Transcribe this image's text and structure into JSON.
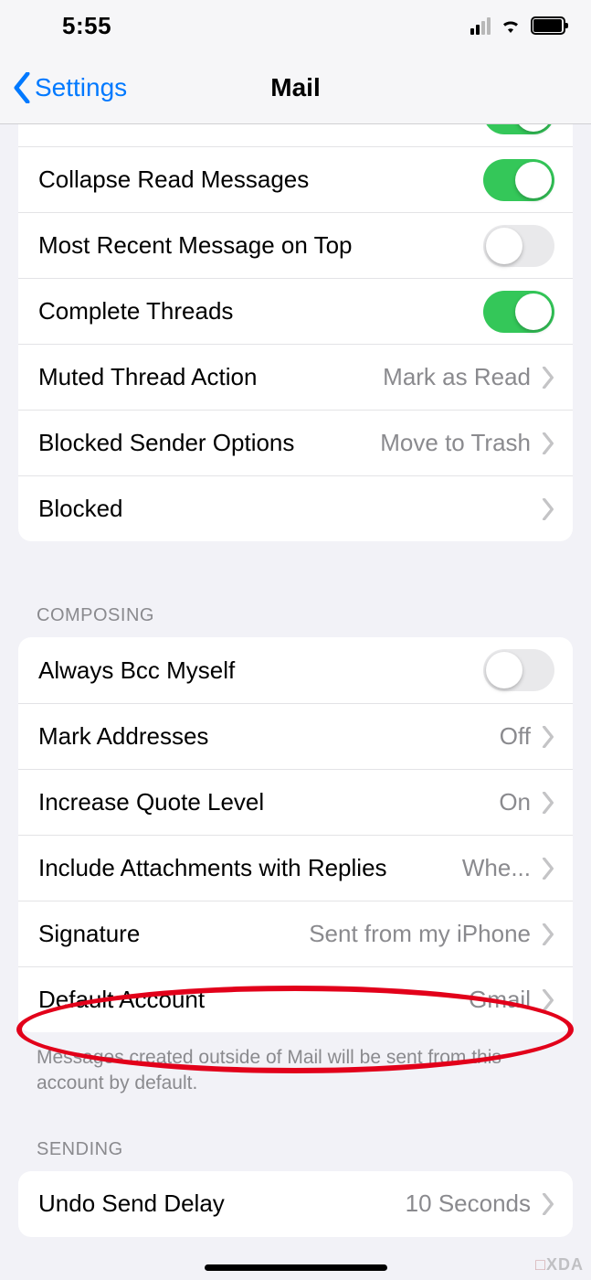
{
  "status": {
    "time": "5:55"
  },
  "nav": {
    "back_label": "Settings",
    "title": "Mail"
  },
  "threading": {
    "rows": [
      {
        "label": "",
        "toggle": true
      },
      {
        "label": "Collapse Read Messages",
        "toggle": true
      },
      {
        "label": "Most Recent Message on Top",
        "toggle": false
      },
      {
        "label": "Complete Threads",
        "toggle": true
      },
      {
        "label": "Muted Thread Action",
        "value": "Mark as Read"
      },
      {
        "label": "Blocked Sender Options",
        "value": "Move to Trash"
      },
      {
        "label": "Blocked"
      }
    ]
  },
  "composing": {
    "header": "COMPOSING",
    "rows": [
      {
        "label": "Always Bcc Myself",
        "toggle": false
      },
      {
        "label": "Mark Addresses",
        "value": "Off"
      },
      {
        "label": "Increase Quote Level",
        "value": "On"
      },
      {
        "label": "Include Attachments with Replies",
        "value": "Whe..."
      },
      {
        "label": "Signature",
        "value": "Sent from my iPhone"
      },
      {
        "label": "Default Account",
        "value": "Gmail"
      }
    ],
    "footer": "Messages created outside of Mail will be sent from this account by default."
  },
  "sending": {
    "header": "SENDING",
    "rows": [
      {
        "label": "Undo Send Delay",
        "value": "10 Seconds"
      }
    ]
  },
  "watermark": "XDA"
}
